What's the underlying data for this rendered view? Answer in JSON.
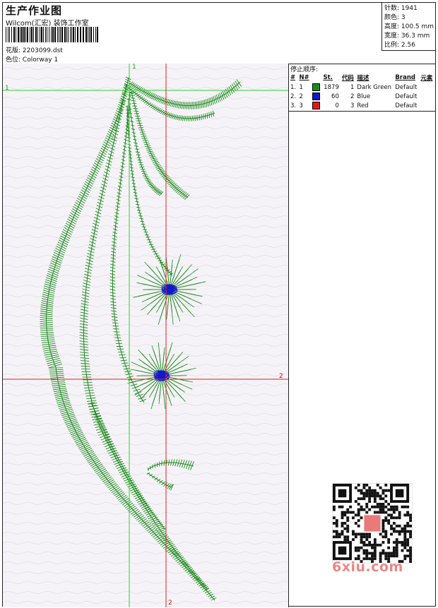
{
  "header": {
    "title": "生产作业图",
    "company": "Wilcom(汇宏) 装饰工作室",
    "design_label": "花版:",
    "design_value": "2203099.dst",
    "color_label": "色位:",
    "color_value": "Colorway 1"
  },
  "stats": {
    "stitches": "针数: 1941",
    "colors": "颜色: 3",
    "height": "高度: 100.5 mm",
    "width": "宽度: 36.3 mm",
    "scale": "比例: 2.56"
  },
  "stop_sequence": {
    "title": "停止顺序:",
    "headers": [
      "#",
      "N#",
      "",
      "St.",
      "代码",
      "描述",
      "Brand",
      "元素"
    ],
    "rows": [
      {
        "index": "1.",
        "n": "1",
        "color": "#1a8a1a",
        "stitches": "1879",
        "code": "1",
        "desc": "Dark Green",
        "brand": "Default"
      },
      {
        "index": "2.",
        "n": "2",
        "color": "#1515d0",
        "stitches": "60",
        "code": "2",
        "desc": "Blue",
        "brand": "Default"
      },
      {
        "index": "3.",
        "n": "3",
        "color": "#e01818",
        "stitches": "0",
        "code": "3",
        "desc": "Red",
        "brand": "Default"
      }
    ]
  },
  "guides": {
    "label_1": "1",
    "label_1_top": "1",
    "label_2_right": "2",
    "label_2_bottom": "2"
  },
  "watermark": {
    "text": "6xiu.com"
  },
  "palette": {
    "thread_green": "#1a8a1a",
    "thread_blue": "#1515d0",
    "guide_red": "#e02020",
    "guide_green": "#30d030"
  }
}
